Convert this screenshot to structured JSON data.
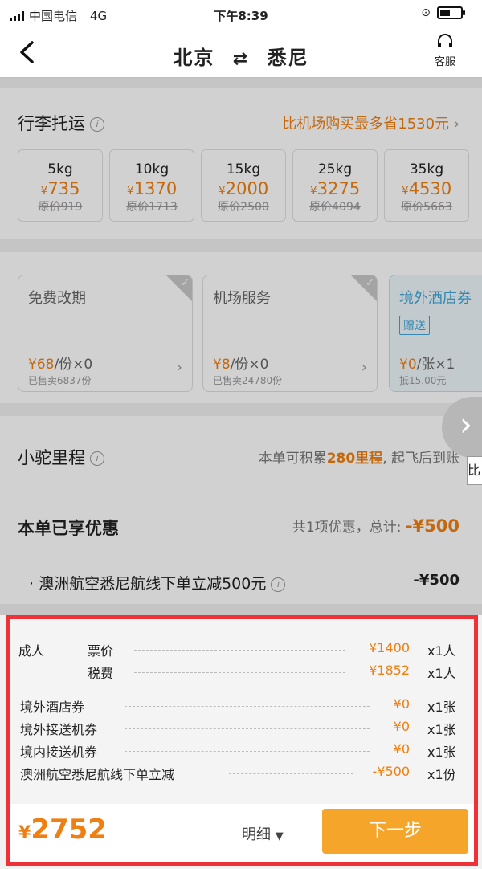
{
  "status_bar": {
    "carrier": "中国电信",
    "network": "4G",
    "time": "下午8:39"
  },
  "header": {
    "from": "北京",
    "to": "悉尼",
    "swap_glyph": "⇄",
    "service_label": "客服"
  },
  "luggage": {
    "title": "行李托运",
    "promo": "比机场购买最多省1530元",
    "options": [
      {
        "weight": "5kg",
        "price": "735",
        "original": "原价919"
      },
      {
        "weight": "10kg",
        "price": "1370",
        "original": "原价1713"
      },
      {
        "weight": "15kg",
        "price": "2000",
        "original": "原价2500"
      },
      {
        "weight": "25kg",
        "price": "3275",
        "original": "原价4094"
      },
      {
        "weight": "35kg",
        "price": "4530",
        "original": "原价5663"
      }
    ]
  },
  "services": [
    {
      "title": "免费改期",
      "price": "¥68",
      "unit": "/份×0",
      "sold": "已售卖6837份"
    },
    {
      "title": "机场服务",
      "price": "¥8",
      "unit": "/份×0",
      "sold": "已售卖24780份"
    },
    {
      "title": "境外酒店券",
      "tag": "赠送",
      "price": "¥0",
      "unit": "/张×1",
      "sold": "抵15.00元"
    }
  ],
  "miles": {
    "title": "小驼里程",
    "prefix": "本单可积累",
    "amount": "280里程",
    "suffix": ", 起飞后到账",
    "side_label": "比"
  },
  "discounts": {
    "title": "本单已享优惠",
    "summary": "共1项优惠，总计: ",
    "total": "-¥500",
    "item": "· 澳洲航空悉尼航线下单立减500元",
    "item_amount": "-¥500"
  },
  "breakdown": {
    "adult_label": "成人",
    "rows": [
      {
        "label": "票价",
        "amount": "¥1400",
        "qty": "x1人"
      },
      {
        "label": "税费",
        "amount": "¥1852",
        "qty": "x1人"
      },
      {
        "label": "境外酒店券",
        "amount": "¥0",
        "qty": "x1张"
      },
      {
        "label": "境外接送机券",
        "amount": "¥0",
        "qty": "x1张"
      },
      {
        "label": "境内接送机券",
        "amount": "¥0",
        "qty": "x1张"
      },
      {
        "label": "澳洲航空悉尼航线下单立减",
        "amount": "-¥500",
        "qty": "x1份"
      }
    ]
  },
  "footer": {
    "currency": "¥",
    "total": "2752",
    "detail_label": "明细",
    "next_label": "下一步"
  },
  "colors": {
    "accent": "#f07f11",
    "button": "#f5a52a",
    "highlight_border": "#ef3237",
    "tag_blue": "#3ea6d8"
  }
}
